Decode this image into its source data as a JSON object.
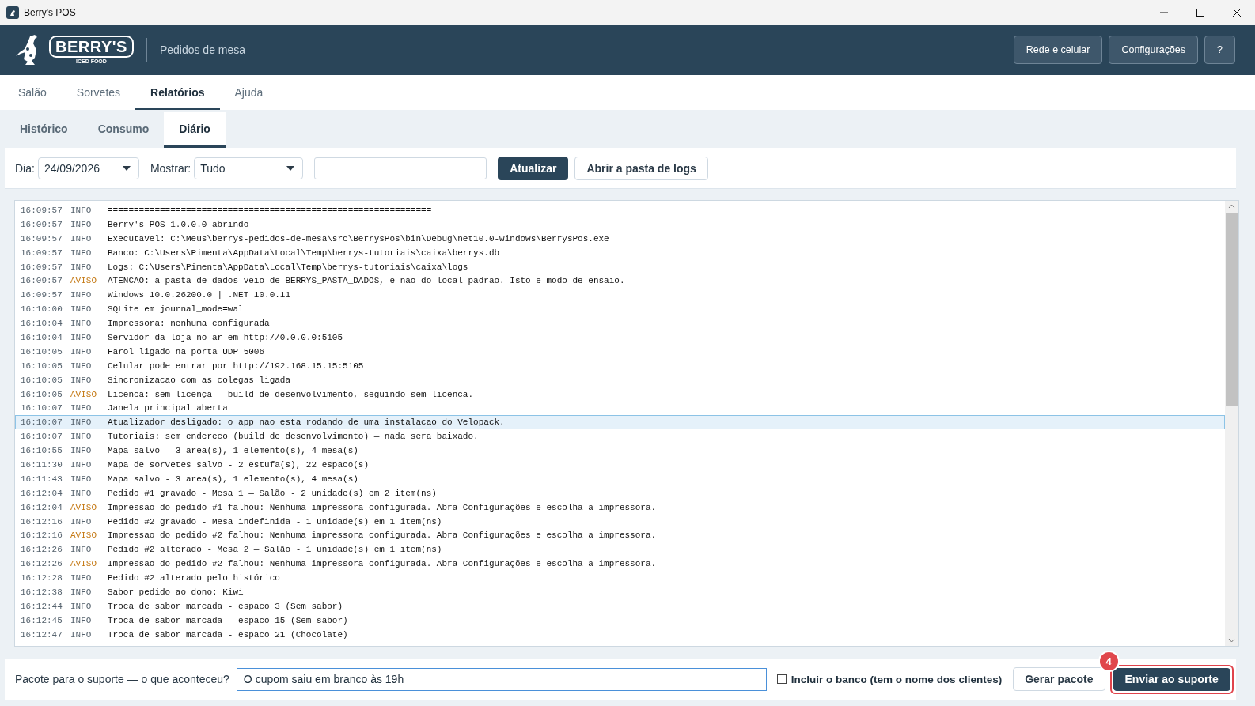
{
  "window": {
    "title": "Berry's POS"
  },
  "header": {
    "brand": "BERRY'S",
    "brand_sub": "ICED FOOD",
    "subtitle": "Pedidos de mesa",
    "buttons": [
      "Rede e celular",
      "Configurações",
      "?"
    ]
  },
  "tabs": [
    {
      "label": "Salão",
      "selected": false
    },
    {
      "label": "Sorvetes",
      "selected": false
    },
    {
      "label": "Relatórios",
      "selected": true
    },
    {
      "label": "Ajuda",
      "selected": false
    }
  ],
  "subtabs": [
    {
      "label": "Histórico",
      "selected": false
    },
    {
      "label": "Consumo",
      "selected": false
    },
    {
      "label": "Diário",
      "selected": true
    }
  ],
  "filters": {
    "day_label": "Dia:",
    "day_value": "24/09/2026",
    "show_label": "Mostrar:",
    "show_value": "Tudo",
    "refresh_button": "Atualizar",
    "open_logs_button": "Abrir a pasta de logs"
  },
  "log": {
    "rows": [
      {
        "time": "16:09:57",
        "level": "INFO",
        "kind": "info",
        "message": "==============================================================",
        "selected": false
      },
      {
        "time": "16:09:57",
        "level": "INFO",
        "kind": "info",
        "message": "Berry's POS 1.0.0.0 abrindo",
        "selected": false
      },
      {
        "time": "16:09:57",
        "level": "INFO",
        "kind": "info",
        "message": "Executavel: C:\\Meus\\berrys-pedidos-de-mesa\\src\\BerrysPos\\bin\\Debug\\net10.0-windows\\BerrysPos.exe",
        "selected": false
      },
      {
        "time": "16:09:57",
        "level": "INFO",
        "kind": "info",
        "message": "Banco: C:\\Users\\Pimenta\\AppData\\Local\\Temp\\berrys-tutoriais\\caixa\\berrys.db",
        "selected": false
      },
      {
        "time": "16:09:57",
        "level": "INFO",
        "kind": "info",
        "message": "Logs: C:\\Users\\Pimenta\\AppData\\Local\\Temp\\berrys-tutoriais\\caixa\\logs",
        "selected": false
      },
      {
        "time": "16:09:57",
        "level": "AVISO",
        "kind": "warning",
        "message": "ATENCAO: a pasta de dados veio de BERRYS_PASTA_DADOS, e nao do local padrao. Isto e modo de ensaio.",
        "selected": false
      },
      {
        "time": "16:09:57",
        "level": "INFO",
        "kind": "info",
        "message": "Windows 10.0.26200.0 | .NET 10.0.11",
        "selected": false
      },
      {
        "time": "16:10:00",
        "level": "INFO",
        "kind": "info",
        "message": "SQLite em journal_mode=wal",
        "selected": false
      },
      {
        "time": "16:10:04",
        "level": "INFO",
        "kind": "info",
        "message": "Impressora: nenhuma configurada",
        "selected": false
      },
      {
        "time": "16:10:04",
        "level": "INFO",
        "kind": "info",
        "message": "Servidor da loja no ar em http://0.0.0.0:5105",
        "selected": false
      },
      {
        "time": "16:10:05",
        "level": "INFO",
        "kind": "info",
        "message": "Farol ligado na porta UDP 5006",
        "selected": false
      },
      {
        "time": "16:10:05",
        "level": "INFO",
        "kind": "info",
        "message": "Celular pode entrar por http://192.168.15.15:5105",
        "selected": false
      },
      {
        "time": "16:10:05",
        "level": "INFO",
        "kind": "info",
        "message": "Sincronizacao com as colegas ligada",
        "selected": false
      },
      {
        "time": "16:10:05",
        "level": "AVISO",
        "kind": "warning",
        "message": "Licenca: sem licença — build de desenvolvimento, seguindo sem licenca.",
        "selected": false
      },
      {
        "time": "16:10:07",
        "level": "INFO",
        "kind": "info",
        "message": "Janela principal aberta",
        "selected": false
      },
      {
        "time": "16:10:07",
        "level": "INFO",
        "kind": "info",
        "message": "Atualizador desligado: o app nao esta rodando de uma instalacao do Velopack.",
        "selected": true
      },
      {
        "time": "16:10:07",
        "level": "INFO",
        "kind": "info",
        "message": "Tutoriais: sem endereco (build de desenvolvimento) — nada sera baixado.",
        "selected": false
      },
      {
        "time": "16:10:55",
        "level": "INFO",
        "kind": "info",
        "message": "Mapa salvo - 3 area(s), 1 elemento(s), 4 mesa(s)",
        "selected": false
      },
      {
        "time": "16:11:30",
        "level": "INFO",
        "kind": "info",
        "message": "Mapa de sorvetes salvo - 2 estufa(s), 22 espaco(s)",
        "selected": false
      },
      {
        "time": "16:11:43",
        "level": "INFO",
        "kind": "info",
        "message": "Mapa salvo - 3 area(s), 1 elemento(s), 4 mesa(s)",
        "selected": false
      },
      {
        "time": "16:12:04",
        "level": "INFO",
        "kind": "info",
        "message": "Pedido #1 gravado - Mesa 1 — Salão - 2 unidade(s) em 2 item(ns)",
        "selected": false
      },
      {
        "time": "16:12:04",
        "level": "AVISO",
        "kind": "warning",
        "message": "Impressao do pedido #1 falhou: Nenhuma impressora configurada. Abra Configurações e escolha a impressora.",
        "selected": false
      },
      {
        "time": "16:12:16",
        "level": "INFO",
        "kind": "info",
        "message": "Pedido #2 gravado - Mesa indefinida - 1 unidade(s) em 1 item(ns)",
        "selected": false
      },
      {
        "time": "16:12:16",
        "level": "AVISO",
        "kind": "warning",
        "message": "Impressao do pedido #2 falhou: Nenhuma impressora configurada. Abra Configurações e escolha a impressora.",
        "selected": false
      },
      {
        "time": "16:12:26",
        "level": "INFO",
        "kind": "info",
        "message": "Pedido #2 alterado - Mesa 2 — Salão - 1 unidade(s) em 1 item(ns)",
        "selected": false
      },
      {
        "time": "16:12:26",
        "level": "AVISO",
        "kind": "warning",
        "message": "Impressao do pedido #2 falhou: Nenhuma impressora configurada. Abra Configurações e escolha a impressora.",
        "selected": false
      },
      {
        "time": "16:12:28",
        "level": "INFO",
        "kind": "info",
        "message": "Pedido #2 alterado pelo histórico",
        "selected": false
      },
      {
        "time": "16:12:38",
        "level": "INFO",
        "kind": "info",
        "message": "Sabor pedido ao dono: Kiwi",
        "selected": false
      },
      {
        "time": "16:12:44",
        "level": "INFO",
        "kind": "info",
        "message": "Troca de sabor marcada - espaco 3 (Sem sabor)",
        "selected": false
      },
      {
        "time": "16:12:45",
        "level": "INFO",
        "kind": "info",
        "message": "Troca de sabor marcada - espaco 15 (Sem sabor)",
        "selected": false
      },
      {
        "time": "16:12:47",
        "level": "INFO",
        "kind": "info",
        "message": "Troca de sabor marcada - espaco 21 (Chocolate)",
        "selected": false
      }
    ]
  },
  "support": {
    "label": "Pacote para o suporte — o que aconteceu?",
    "value": "O cupom saiu em branco às 19h",
    "include_db": {
      "label": "Incluir o banco (tem o nome dos clientes)",
      "checked": false
    },
    "generate_button": "Gerar pacote",
    "send_button": "Enviar ao suporte",
    "step_badge": "4"
  }
}
